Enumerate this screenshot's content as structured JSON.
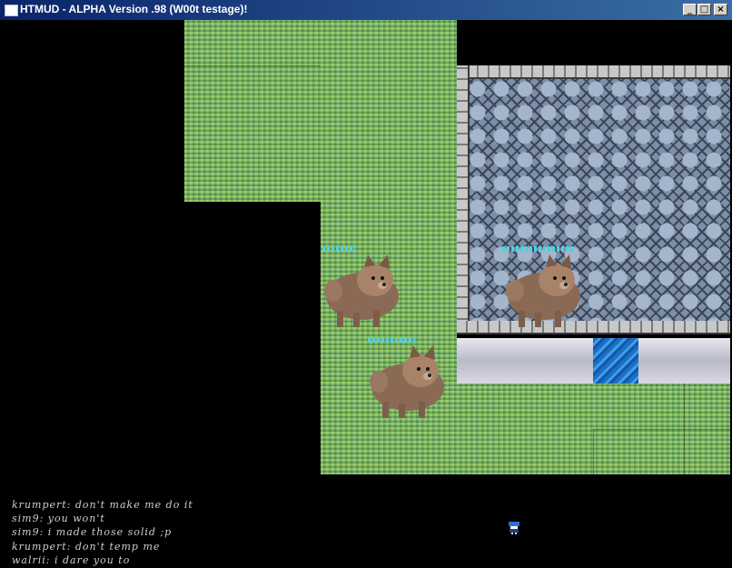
{
  "window": {
    "title": "HTMUD - ALPHA Version .98 (W00t testage)!",
    "buttons": {
      "minimize": "_",
      "maximize": "□",
      "close": "×"
    }
  },
  "game": {
    "tiles": [
      "grass",
      "stone-floor",
      "stone-wall",
      "marble-ledge",
      "water"
    ],
    "characters": [
      {
        "sprite": "dog"
      },
      {
        "sprite": "dog"
      },
      {
        "sprite": "dog"
      }
    ],
    "player_sprite": "player-icon"
  },
  "chat": {
    "lines": [
      "krumpert: don't make me do it",
      "sim9: you won't",
      "sim9: i made those solid ;p",
      "krumpert: don't temp me",
      "walrii: i dare you to"
    ]
  },
  "colors": {
    "title_bar": "#0a246a",
    "grass": "#6ca84a",
    "floor": "#7d8fa8",
    "water": "#1c6fc4",
    "chat_text": "#cfcfcf",
    "name_tag": "#50d0e0"
  }
}
